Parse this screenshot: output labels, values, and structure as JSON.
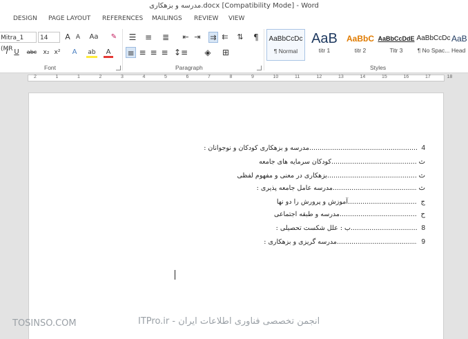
{
  "window": {
    "title": "مدرسه و بزهکاری.docx [Compatibility Mode] - Word"
  },
  "tabs": [
    {
      "label": "DESIGN"
    },
    {
      "label": "PAGE LAYOUT"
    },
    {
      "label": "REFERENCES"
    },
    {
      "label": "MAILINGS"
    },
    {
      "label": "REVIEW"
    },
    {
      "label": "VIEW"
    }
  ],
  "ribbon": {
    "font": {
      "name": "Mitra_1 (MR",
      "size": "14",
      "group_label": "Font"
    },
    "paragraph": {
      "group_label": "Paragraph"
    },
    "styles": {
      "group_label": "Styles",
      "items": [
        {
          "preview": "AaBbCcDc",
          "name": "¶ Normal",
          "selected": true
        },
        {
          "preview": "AaB",
          "name": "titr 1"
        },
        {
          "preview": "AaBbC",
          "name": "titr 2"
        },
        {
          "preview": "AaBbCcDdE",
          "name": "Titr 3"
        },
        {
          "preview": "AaBbCcDc",
          "name": "¶ No Spac..."
        },
        {
          "preview": "AaB",
          "name": "Head"
        }
      ]
    },
    "icons": {
      "grow_font": "A",
      "shrink_font": "A",
      "change_case": "Aa",
      "italic": "I",
      "underline": "U",
      "strikethrough": "abc",
      "subscript": "x₂",
      "superscript": "x²",
      "text_effects": "A",
      "highlight": "ab",
      "font_color": "A",
      "show_marks": "¶"
    }
  },
  "ruler": {
    "numbers": [
      "2",
      "1",
      "1",
      "2",
      "3",
      "4",
      "5",
      "6",
      "7",
      "8",
      "9",
      "10",
      "11",
      "12",
      "13",
      "14",
      "15",
      "16",
      "17",
      "18",
      "19"
    ]
  },
  "document": {
    "entries": [
      {
        "text": "مدرسه و بزهکاری کودکان و نوجوانان :",
        "page": "4"
      },
      {
        "text": "کودکان سرمایه های جامعه",
        "page": "ث"
      },
      {
        "text": "بزهکاری در معنی و مفهوم لفظی",
        "page": "ث"
      },
      {
        "text": "مدرسه عامل جامعه پذیری :",
        "page": "ث"
      },
      {
        "text": "آموزش و پرورش را دو نها",
        "page": "ج"
      },
      {
        "text": "مدرسه و طبقه اجتماعی",
        "page": "ح"
      },
      {
        "text": "ب : علل شکست تحصیلی :",
        "page": "8"
      },
      {
        "text": "مدرسه گریزی و بزهکاری :",
        "page": "9"
      }
    ]
  },
  "watermark": {
    "left": "TOSINSO.COM",
    "right": "ITPro.ir - انجمن تخصصی فناوری اطلاعات ایران"
  }
}
